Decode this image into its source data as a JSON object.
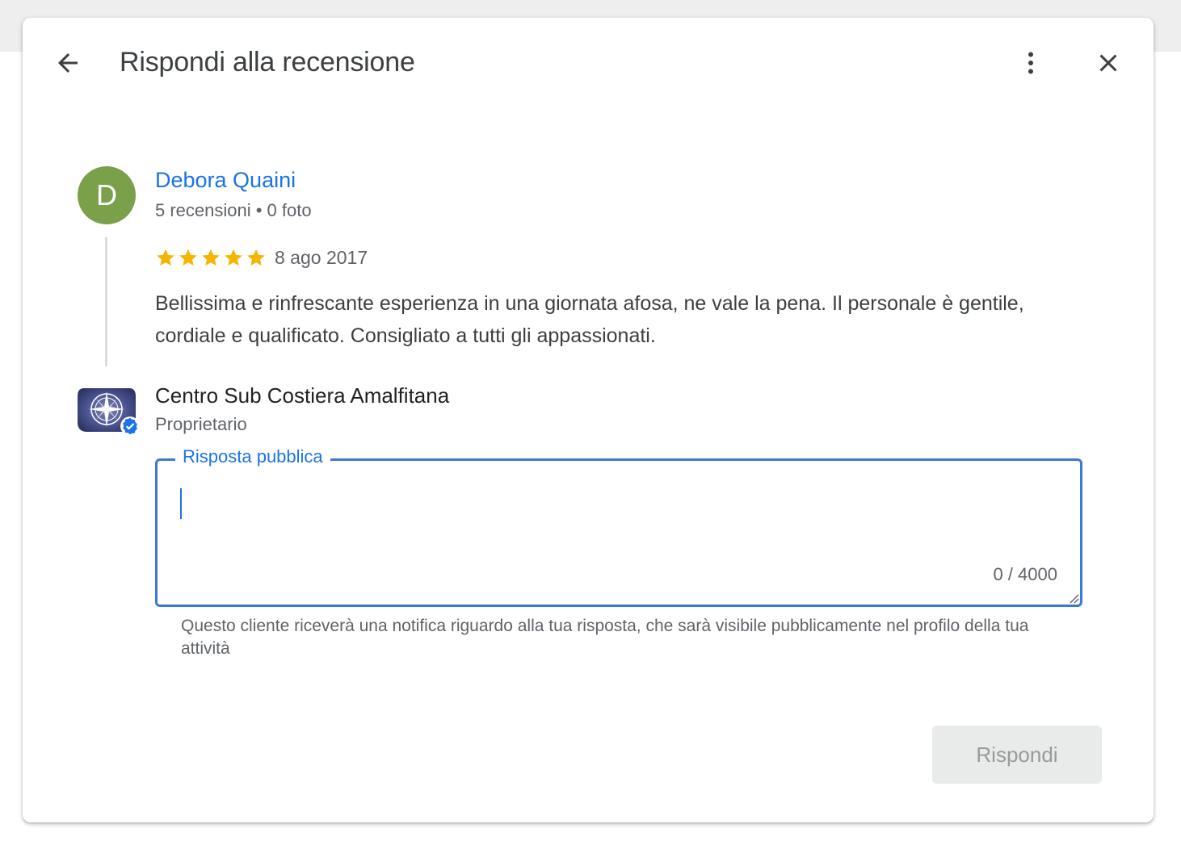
{
  "dialog": {
    "title": "Rispondi alla recensione",
    "back_icon": "arrow-left-icon",
    "more_icon": "more-vertical-icon",
    "close_icon": "close-icon"
  },
  "review": {
    "avatar_initial": "D",
    "avatar_color": "#7aa049",
    "author": "Debora Quaini",
    "meta": "5 recensioni • 0 foto",
    "rating": 5,
    "date": "8 ago 2017",
    "text": "Bellissima e rinfrescante esperienza in una giornata afosa, ne vale la pena. Il personale è gentile, cordiale e qualificato. Consigliato a tutti gli appassionati."
  },
  "owner": {
    "name": "Centro Sub Costiera Amalfitana",
    "role": "Proprietario",
    "avatar_icon": "compass-rose-icon",
    "verified_icon": "verified-badge-icon"
  },
  "reply": {
    "label": "Risposta pubblica",
    "value": "",
    "counter": "0 / 4000",
    "helper": "Questo cliente riceverà una notifica riguardo alla tua risposta, che sarà visibile pubblicamente nel profilo della tua attività",
    "submit_label": "Rispondi"
  },
  "colors": {
    "accent": "#1a73e8",
    "star": "#f4b400",
    "field_border": "#3c78d8"
  }
}
